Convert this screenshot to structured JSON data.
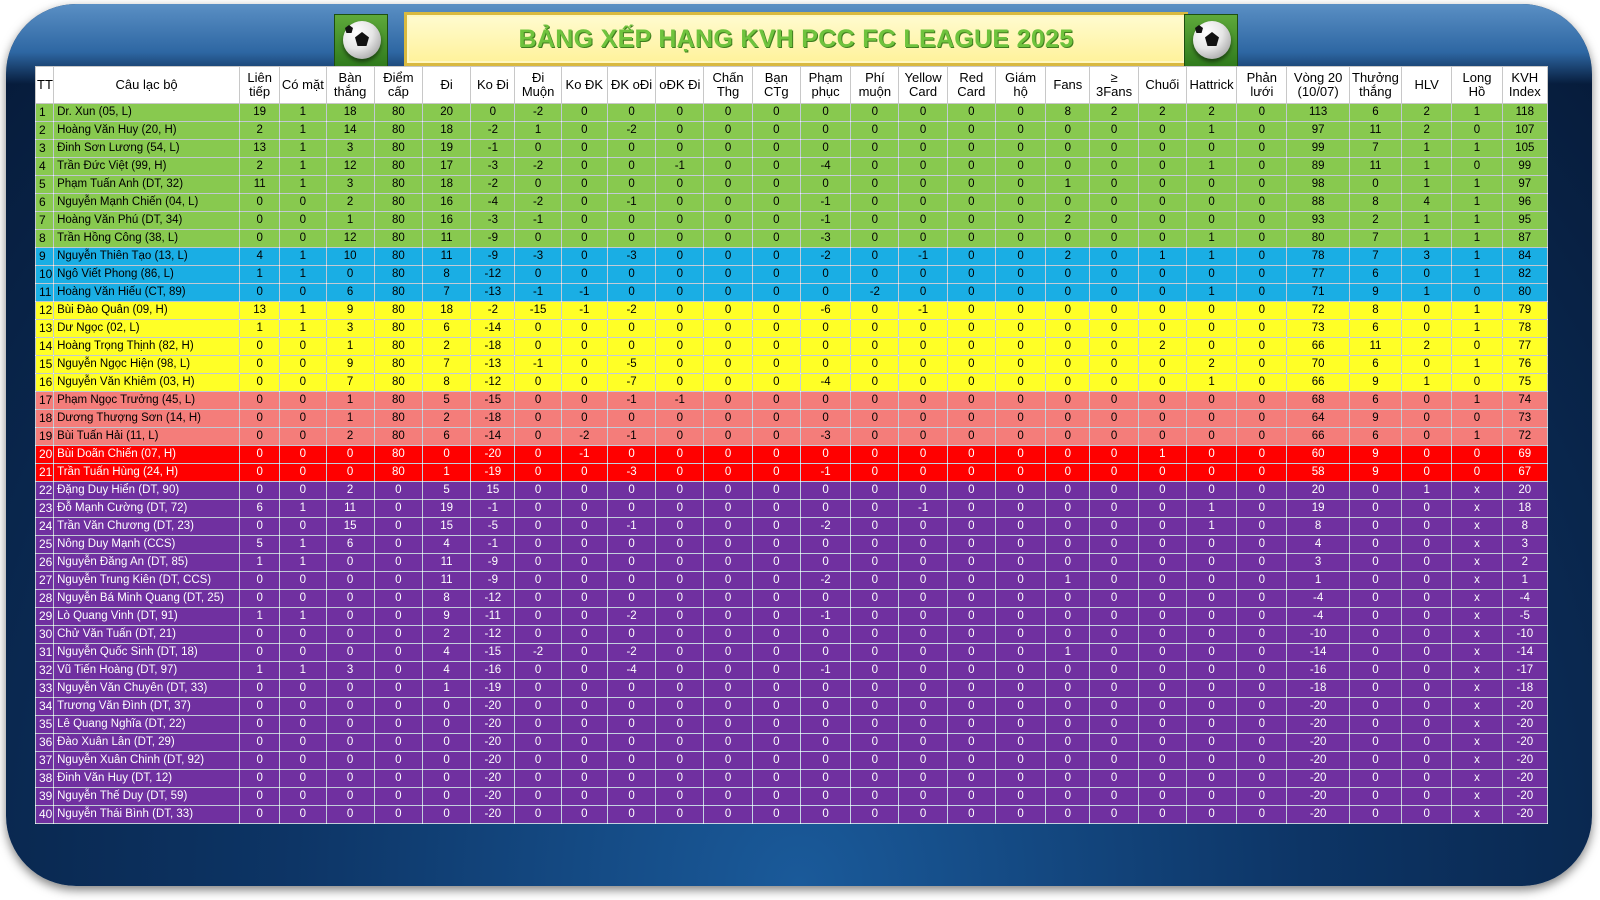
{
  "title": "BẢNG XẾP HẠNG KVH PCC FC LEAGUE 2025",
  "columns": [
    "TT",
    "Câu lạc bộ",
    "Liên tiếp",
    "Có mặt",
    "Bàn thắng",
    "Điểm cấp",
    "Đi",
    "Ko Đi",
    "Đi Muộn",
    "Ko ĐK",
    "ĐK oĐi",
    "oĐK Đi",
    "Chấn Thg",
    "Bạn CTg",
    "Phạm phục",
    "Phí muộn",
    "Yellow Card",
    "Red Card",
    "Giám hộ",
    "Fans",
    "≥ 3Fans",
    "Chuối",
    "Hattrick",
    "Phản lưới",
    "Vòng 20 (10/07)",
    "Thưởng thắng",
    "HLV",
    "Long Hồ",
    "KVH Index"
  ],
  "rows": [
    {
      "tt": "1",
      "name": "Dr. Xun (05, L)",
      "band": "green",
      "vals": [
        "19",
        "1",
        "18",
        "80",
        "20",
        "0",
        "-2",
        "0",
        "0",
        "0",
        "0",
        "0",
        "0",
        "0",
        "0",
        "0",
        "0",
        "8",
        "2",
        "2",
        "2",
        "0",
        "113",
        "6",
        "2",
        "1",
        "118"
      ]
    },
    {
      "tt": "2",
      "name": "Hoàng Văn Huy (20, H)",
      "band": "green",
      "vals": [
        "2",
        "1",
        "14",
        "80",
        "18",
        "-2",
        "1",
        "0",
        "-2",
        "0",
        "0",
        "0",
        "0",
        "0",
        "0",
        "0",
        "0",
        "0",
        "0",
        "0",
        "1",
        "0",
        "97",
        "11",
        "2",
        "0",
        "107"
      ]
    },
    {
      "tt": "3",
      "name": "Đinh Sơn Lương (54, L)",
      "band": "green",
      "vals": [
        "13",
        "1",
        "3",
        "80",
        "19",
        "-1",
        "0",
        "0",
        "0",
        "0",
        "0",
        "0",
        "0",
        "0",
        "0",
        "0",
        "0",
        "0",
        "0",
        "0",
        "0",
        "0",
        "99",
        "7",
        "1",
        "1",
        "105"
      ]
    },
    {
      "tt": "4",
      "name": "Trần Đức Việt (99, H)",
      "band": "green",
      "vals": [
        "2",
        "1",
        "12",
        "80",
        "17",
        "-3",
        "-2",
        "0",
        "0",
        "-1",
        "0",
        "0",
        "-4",
        "0",
        "0",
        "0",
        "0",
        "0",
        "0",
        "0",
        "1",
        "0",
        "89",
        "11",
        "1",
        "0",
        "99"
      ]
    },
    {
      "tt": "5",
      "name": "Phạm Tuấn Anh (DT, 32)",
      "band": "green",
      "vals": [
        "11",
        "1",
        "3",
        "80",
        "18",
        "-2",
        "0",
        "0",
        "0",
        "0",
        "0",
        "0",
        "0",
        "0",
        "0",
        "0",
        "0",
        "1",
        "0",
        "0",
        "0",
        "0",
        "98",
        "0",
        "1",
        "1",
        "97"
      ]
    },
    {
      "tt": "6",
      "name": "Nguyễn Mạnh Chiến (04, L)",
      "band": "green",
      "vals": [
        "0",
        "0",
        "2",
        "80",
        "16",
        "-4",
        "-2",
        "0",
        "-1",
        "0",
        "0",
        "0",
        "-1",
        "0",
        "0",
        "0",
        "0",
        "0",
        "0",
        "0",
        "0",
        "0",
        "88",
        "8",
        "4",
        "1",
        "96"
      ]
    },
    {
      "tt": "7",
      "name": "Hoàng Văn Phú (DT, 34)",
      "band": "green",
      "vals": [
        "0",
        "0",
        "1",
        "80",
        "16",
        "-3",
        "-1",
        "0",
        "0",
        "0",
        "0",
        "0",
        "-1",
        "0",
        "0",
        "0",
        "0",
        "2",
        "0",
        "0",
        "0",
        "0",
        "93",
        "2",
        "1",
        "1",
        "95"
      ]
    },
    {
      "tt": "8",
      "name": "Trần Hồng Công (38, L)",
      "band": "green",
      "vals": [
        "0",
        "0",
        "12",
        "80",
        "11",
        "-9",
        "0",
        "0",
        "0",
        "0",
        "0",
        "0",
        "-3",
        "0",
        "0",
        "0",
        "0",
        "0",
        "0",
        "0",
        "1",
        "0",
        "80",
        "7",
        "1",
        "1",
        "87"
      ]
    },
    {
      "tt": "9",
      "name": "Nguyễn Thiên Tạo (13, L)",
      "band": "blue",
      "vals": [
        "4",
        "1",
        "10",
        "80",
        "11",
        "-9",
        "-3",
        "0",
        "-3",
        "0",
        "0",
        "0",
        "-2",
        "0",
        "-1",
        "0",
        "0",
        "2",
        "0",
        "1",
        "1",
        "0",
        "78",
        "7",
        "3",
        "1",
        "84"
      ]
    },
    {
      "tt": "10",
      "name": "Ngô Viết Phong (86, L)",
      "band": "blue",
      "vals": [
        "1",
        "1",
        "0",
        "80",
        "8",
        "-12",
        "0",
        "0",
        "0",
        "0",
        "0",
        "0",
        "0",
        "0",
        "0",
        "0",
        "0",
        "0",
        "0",
        "0",
        "0",
        "0",
        "77",
        "6",
        "0",
        "1",
        "82"
      ]
    },
    {
      "tt": "11",
      "name": "Hoàng Văn Hiếu (CT, 89)",
      "band": "blue",
      "vals": [
        "0",
        "0",
        "6",
        "80",
        "7",
        "-13",
        "-1",
        "-1",
        "0",
        "0",
        "0",
        "0",
        "0",
        "-2",
        "0",
        "0",
        "0",
        "0",
        "0",
        "0",
        "1",
        "0",
        "71",
        "9",
        "1",
        "0",
        "80"
      ]
    },
    {
      "tt": "12",
      "name": "Bùi Đào Quân (09, H)",
      "band": "yellow",
      "vals": [
        "13",
        "1",
        "9",
        "80",
        "18",
        "-2",
        "-15",
        "-1",
        "-2",
        "0",
        "0",
        "0",
        "-6",
        "0",
        "-1",
        "0",
        "0",
        "0",
        "0",
        "0",
        "0",
        "0",
        "72",
        "8",
        "0",
        "1",
        "79"
      ]
    },
    {
      "tt": "13",
      "name": "Dư Ngọc (02, L)",
      "band": "yellow",
      "vals": [
        "1",
        "1",
        "3",
        "80",
        "6",
        "-14",
        "0",
        "0",
        "0",
        "0",
        "0",
        "0",
        "0",
        "0",
        "0",
        "0",
        "0",
        "0",
        "0",
        "0",
        "0",
        "0",
        "73",
        "6",
        "0",
        "1",
        "78"
      ]
    },
    {
      "tt": "14",
      "name": "Hoàng Trọng Thịnh (82, H)",
      "band": "yellow",
      "vals": [
        "0",
        "0",
        "1",
        "80",
        "2",
        "-18",
        "0",
        "0",
        "0",
        "0",
        "0",
        "0",
        "0",
        "0",
        "0",
        "0",
        "0",
        "0",
        "0",
        "2",
        "0",
        "0",
        "66",
        "11",
        "2",
        "0",
        "77"
      ]
    },
    {
      "tt": "15",
      "name": "Nguyễn Ngọc Hiện (98, L)",
      "band": "yellow",
      "vals": [
        "0",
        "0",
        "9",
        "80",
        "7",
        "-13",
        "-1",
        "0",
        "-5",
        "0",
        "0",
        "0",
        "0",
        "0",
        "0",
        "0",
        "0",
        "0",
        "0",
        "0",
        "2",
        "0",
        "70",
        "6",
        "0",
        "1",
        "76"
      ]
    },
    {
      "tt": "16",
      "name": "Nguyễn Văn Khiêm (03, H)",
      "band": "yellow",
      "vals": [
        "0",
        "0",
        "7",
        "80",
        "8",
        "-12",
        "0",
        "0",
        "-7",
        "0",
        "0",
        "0",
        "-4",
        "0",
        "0",
        "0",
        "0",
        "0",
        "0",
        "0",
        "1",
        "0",
        "66",
        "9",
        "1",
        "0",
        "75"
      ]
    },
    {
      "tt": "17",
      "name": "Phạm Ngọc Trưởng (45, L)",
      "band": "pink",
      "vals": [
        "0",
        "0",
        "1",
        "80",
        "5",
        "-15",
        "0",
        "0",
        "-1",
        "-1",
        "0",
        "0",
        "0",
        "0",
        "0",
        "0",
        "0",
        "0",
        "0",
        "0",
        "0",
        "0",
        "68",
        "6",
        "0",
        "1",
        "74"
      ]
    },
    {
      "tt": "18",
      "name": "Dương Thượng Sơn (14, H)",
      "band": "pink",
      "vals": [
        "0",
        "0",
        "1",
        "80",
        "2",
        "-18",
        "0",
        "0",
        "0",
        "0",
        "0",
        "0",
        "0",
        "0",
        "0",
        "0",
        "0",
        "0",
        "0",
        "0",
        "0",
        "0",
        "64",
        "9",
        "0",
        "0",
        "73"
      ]
    },
    {
      "tt": "19",
      "name": "Bùi Tuấn Hải (11, L)",
      "band": "pink",
      "vals": [
        "0",
        "0",
        "2",
        "80",
        "6",
        "-14",
        "0",
        "-2",
        "-1",
        "0",
        "0",
        "0",
        "-3",
        "0",
        "0",
        "0",
        "0",
        "0",
        "0",
        "0",
        "0",
        "0",
        "66",
        "6",
        "0",
        "1",
        "72"
      ]
    },
    {
      "tt": "20",
      "name": "Bùi Doãn Chiến (07, H)",
      "band": "red",
      "vals": [
        "0",
        "0",
        "0",
        "80",
        "0",
        "-20",
        "0",
        "-1",
        "0",
        "0",
        "0",
        "0",
        "0",
        "0",
        "0",
        "0",
        "0",
        "0",
        "0",
        "1",
        "0",
        "0",
        "60",
        "9",
        "0",
        "0",
        "69"
      ]
    },
    {
      "tt": "21",
      "name": "Trần Tuấn Hùng (24, H)",
      "band": "red",
      "vals": [
        "0",
        "0",
        "0",
        "80",
        "1",
        "-19",
        "0",
        "0",
        "-3",
        "0",
        "0",
        "0",
        "-1",
        "0",
        "0",
        "0",
        "0",
        "0",
        "0",
        "0",
        "0",
        "0",
        "58",
        "9",
        "0",
        "0",
        "67"
      ]
    },
    {
      "tt": "22",
      "name": "Đặng Duy Hiển (DT, 90)",
      "band": "purple",
      "vals": [
        "0",
        "0",
        "2",
        "0",
        "5",
        "15",
        "0",
        "0",
        "0",
        "0",
        "0",
        "0",
        "0",
        "0",
        "0",
        "0",
        "0",
        "0",
        "0",
        "0",
        "0",
        "0",
        "20",
        "0",
        "1",
        "x",
        "20"
      ]
    },
    {
      "tt": "23",
      "name": "Đỗ Mạnh Cường (DT, 72)",
      "band": "purple",
      "vals": [
        "6",
        "1",
        "11",
        "0",
        "19",
        "-1",
        "0",
        "0",
        "0",
        "0",
        "0",
        "0",
        "0",
        "0",
        "-1",
        "0",
        "0",
        "0",
        "0",
        "0",
        "1",
        "0",
        "19",
        "0",
        "0",
        "x",
        "18"
      ]
    },
    {
      "tt": "24",
      "name": "Trần Văn Chương (DT, 23)",
      "band": "purple",
      "vals": [
        "0",
        "0",
        "15",
        "0",
        "15",
        "-5",
        "0",
        "0",
        "-1",
        "0",
        "0",
        "0",
        "-2",
        "0",
        "0",
        "0",
        "0",
        "0",
        "0",
        "0",
        "1",
        "0",
        "8",
        "0",
        "0",
        "x",
        "8"
      ]
    },
    {
      "tt": "25",
      "name": "Nông Duy Mạnh (CCS)",
      "band": "purple",
      "vals": [
        "5",
        "1",
        "6",
        "0",
        "4",
        "-1",
        "0",
        "0",
        "0",
        "0",
        "0",
        "0",
        "0",
        "0",
        "0",
        "0",
        "0",
        "0",
        "0",
        "0",
        "0",
        "0",
        "4",
        "0",
        "0",
        "x",
        "3"
      ]
    },
    {
      "tt": "26",
      "name": "Nguyễn Đăng An (DT, 85)",
      "band": "purple",
      "vals": [
        "1",
        "1",
        "0",
        "0",
        "11",
        "-9",
        "0",
        "0",
        "0",
        "0",
        "0",
        "0",
        "0",
        "0",
        "0",
        "0",
        "0",
        "0",
        "0",
        "0",
        "0",
        "0",
        "3",
        "0",
        "0",
        "x",
        "2"
      ]
    },
    {
      "tt": "27",
      "name": "Nguyễn Trung Kiên (DT, CCS)",
      "band": "purple",
      "vals": [
        "0",
        "0",
        "0",
        "0",
        "11",
        "-9",
        "0",
        "0",
        "0",
        "0",
        "0",
        "0",
        "-2",
        "0",
        "0",
        "0",
        "0",
        "1",
        "0",
        "0",
        "0",
        "0",
        "1",
        "0",
        "0",
        "x",
        "1"
      ]
    },
    {
      "tt": "28",
      "name": "Nguyễn Bá Minh Quang (DT, 25)",
      "band": "purple",
      "vals": [
        "0",
        "0",
        "0",
        "0",
        "8",
        "-12",
        "0",
        "0",
        "0",
        "0",
        "0",
        "0",
        "0",
        "0",
        "0",
        "0",
        "0",
        "0",
        "0",
        "0",
        "0",
        "0",
        "-4",
        "0",
        "0",
        "x",
        "-4"
      ]
    },
    {
      "tt": "29",
      "name": "Lò Quang Vinh (DT, 91)",
      "band": "purple",
      "vals": [
        "1",
        "1",
        "0",
        "0",
        "9",
        "-11",
        "0",
        "0",
        "-2",
        "0",
        "0",
        "0",
        "-1",
        "0",
        "0",
        "0",
        "0",
        "0",
        "0",
        "0",
        "0",
        "0",
        "-4",
        "0",
        "0",
        "x",
        "-5"
      ]
    },
    {
      "tt": "30",
      "name": "Chử Văn Tuấn (DT, 21)",
      "band": "purple",
      "vals": [
        "0",
        "0",
        "0",
        "0",
        "2",
        "-12",
        "0",
        "0",
        "0",
        "0",
        "0",
        "0",
        "0",
        "0",
        "0",
        "0",
        "0",
        "0",
        "0",
        "0",
        "0",
        "0",
        "-10",
        "0",
        "0",
        "x",
        "-10"
      ]
    },
    {
      "tt": "31",
      "name": "Nguyễn Quốc Sinh (DT, 18)",
      "band": "purple",
      "vals": [
        "0",
        "0",
        "0",
        "0",
        "4",
        "-15",
        "-2",
        "0",
        "-2",
        "0",
        "0",
        "0",
        "0",
        "0",
        "0",
        "0",
        "0",
        "1",
        "0",
        "0",
        "0",
        "0",
        "-14",
        "0",
        "0",
        "x",
        "-14"
      ]
    },
    {
      "tt": "32",
      "name": "Vũ Tiến Hoàng (DT, 97)",
      "band": "purple",
      "vals": [
        "1",
        "1",
        "3",
        "0",
        "4",
        "-16",
        "0",
        "0",
        "-4",
        "0",
        "0",
        "0",
        "-1",
        "0",
        "0",
        "0",
        "0",
        "0",
        "0",
        "0",
        "0",
        "0",
        "-16",
        "0",
        "0",
        "x",
        "-17"
      ]
    },
    {
      "tt": "33",
      "name": "Nguyễn Văn Chuyên (DT, 33)",
      "band": "purple",
      "vals": [
        "0",
        "0",
        "0",
        "0",
        "1",
        "-19",
        "0",
        "0",
        "0",
        "0",
        "0",
        "0",
        "0",
        "0",
        "0",
        "0",
        "0",
        "0",
        "0",
        "0",
        "0",
        "0",
        "-18",
        "0",
        "0",
        "x",
        "-18"
      ]
    },
    {
      "tt": "34",
      "name": "Trương Văn Đình (DT, 37)",
      "band": "purple",
      "vals": [
        "0",
        "0",
        "0",
        "0",
        "0",
        "-20",
        "0",
        "0",
        "0",
        "0",
        "0",
        "0",
        "0",
        "0",
        "0",
        "0",
        "0",
        "0",
        "0",
        "0",
        "0",
        "0",
        "-20",
        "0",
        "0",
        "x",
        "-20"
      ]
    },
    {
      "tt": "35",
      "name": "Lê Quang Nghĩa (DT, 22)",
      "band": "purple",
      "vals": [
        "0",
        "0",
        "0",
        "0",
        "0",
        "-20",
        "0",
        "0",
        "0",
        "0",
        "0",
        "0",
        "0",
        "0",
        "0",
        "0",
        "0",
        "0",
        "0",
        "0",
        "0",
        "0",
        "-20",
        "0",
        "0",
        "x",
        "-20"
      ]
    },
    {
      "tt": "36",
      "name": "Đào Xuân Lân (DT, 29)",
      "band": "purple",
      "vals": [
        "0",
        "0",
        "0",
        "0",
        "0",
        "-20",
        "0",
        "0",
        "0",
        "0",
        "0",
        "0",
        "0",
        "0",
        "0",
        "0",
        "0",
        "0",
        "0",
        "0",
        "0",
        "0",
        "-20",
        "0",
        "0",
        "x",
        "-20"
      ]
    },
    {
      "tt": "37",
      "name": "Nguyễn Xuân Chinh (DT, 92)",
      "band": "purple",
      "vals": [
        "0",
        "0",
        "0",
        "0",
        "0",
        "-20",
        "0",
        "0",
        "0",
        "0",
        "0",
        "0",
        "0",
        "0",
        "0",
        "0",
        "0",
        "0",
        "0",
        "0",
        "0",
        "0",
        "-20",
        "0",
        "0",
        "x",
        "-20"
      ]
    },
    {
      "tt": "38",
      "name": "Đinh Văn Huy (DT, 12)",
      "band": "purple",
      "vals": [
        "0",
        "0",
        "0",
        "0",
        "0",
        "-20",
        "0",
        "0",
        "0",
        "0",
        "0",
        "0",
        "0",
        "0",
        "0",
        "0",
        "0",
        "0",
        "0",
        "0",
        "0",
        "0",
        "-20",
        "0",
        "0",
        "x",
        "-20"
      ]
    },
    {
      "tt": "39",
      "name": "Nguyễn Thế Duy (DT, 59)",
      "band": "purple",
      "vals": [
        "0",
        "0",
        "0",
        "0",
        "0",
        "-20",
        "0",
        "0",
        "0",
        "0",
        "0",
        "0",
        "0",
        "0",
        "0",
        "0",
        "0",
        "0",
        "0",
        "0",
        "0",
        "0",
        "-20",
        "0",
        "0",
        "x",
        "-20"
      ]
    },
    {
      "tt": "40",
      "name": "Nguyễn Thái Bình (DT, 33)",
      "band": "purple",
      "vals": [
        "0",
        "0",
        "0",
        "0",
        "0",
        "-20",
        "0",
        "0",
        "0",
        "0",
        "0",
        "0",
        "0",
        "0",
        "0",
        "0",
        "0",
        "0",
        "0",
        "0",
        "0",
        "0",
        "-20",
        "0",
        "0",
        "x",
        "-20"
      ]
    }
  ],
  "colors": {
    "green": "#88c94f",
    "blue": "#1aaee4",
    "yellow": "#ffff26",
    "pink": "#f47d7a",
    "red": "#ff0000",
    "purple": "#7030a0",
    "title_text": "#6fc33d",
    "title_bg": "#fff29a"
  },
  "icons": {
    "left": "soccer-ball-icon",
    "right": "soccer-ball-icon"
  }
}
